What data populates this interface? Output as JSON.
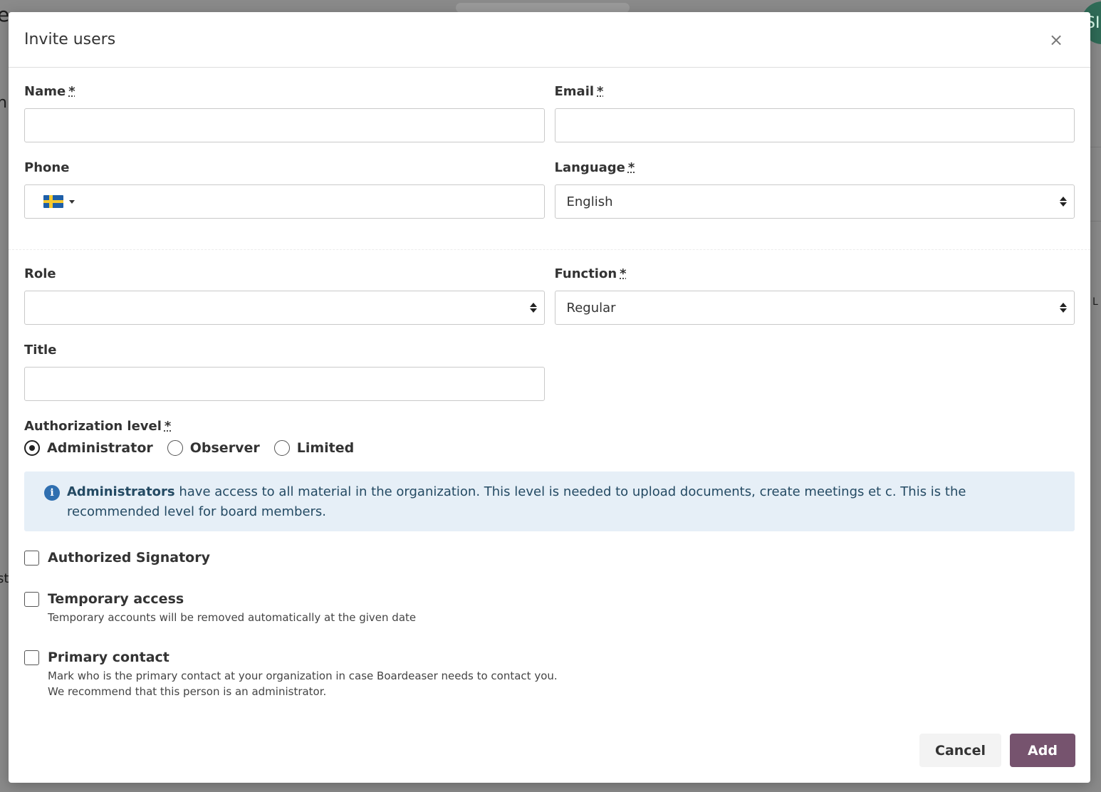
{
  "background": {
    "left_fragment_1": "e",
    "left_fragment_2": "n",
    "left_fragment_3": "st",
    "avatar_text": "SI",
    "right_fragment": "L"
  },
  "modal": {
    "title": "Invite users",
    "close_symbol": "×"
  },
  "fields": {
    "name": {
      "label": "Name",
      "required_mark": "*",
      "value": ""
    },
    "email": {
      "label": "Email",
      "required_mark": "*",
      "value": ""
    },
    "phone": {
      "label": "Phone",
      "country": "Sweden",
      "value": ""
    },
    "language": {
      "label": "Language",
      "required_mark": "*",
      "value": "English"
    },
    "role": {
      "label": "Role",
      "value": ""
    },
    "function": {
      "label": "Function",
      "required_mark": "*",
      "value": "Regular"
    },
    "title": {
      "label": "Title",
      "value": ""
    }
  },
  "authorization": {
    "label": "Authorization level",
    "required_mark": "*",
    "options": [
      "Administrator",
      "Observer",
      "Limited"
    ],
    "selected": "Administrator"
  },
  "info": {
    "icon": "i",
    "strong": "Administrators",
    "text": " have access to all material in the organization. This level is needed to upload documents, create meetings et c. This is the recommended level for board members."
  },
  "checkboxes": {
    "signatory": {
      "label": "Authorized Signatory",
      "checked": false
    },
    "temporary": {
      "label": "Temporary access",
      "help": "Temporary accounts will be removed automatically at the given date",
      "checked": false
    },
    "primary": {
      "label": "Primary contact",
      "help_1": "Mark who is the primary contact at your organization in case Boardeaser needs to contact you.",
      "help_2": "We recommend that this person is an administrator.",
      "checked": false
    }
  },
  "buttons": {
    "cancel": "Cancel",
    "add": "Add"
  },
  "colors": {
    "primary_button": "#76536e",
    "info_background": "#e6eff7",
    "info_icon": "#2f6fb0"
  }
}
